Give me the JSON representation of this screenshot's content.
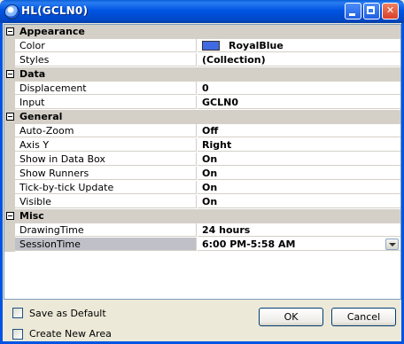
{
  "window": {
    "title": "HL(GCLN0)"
  },
  "grid": {
    "categories": [
      {
        "label": "Appearance",
        "props": [
          {
            "name": "Color",
            "value": "RoyalBlue",
            "swatch": "#4169e1"
          },
          {
            "name": "Styles",
            "value": "(Collection)"
          }
        ]
      },
      {
        "label": "Data",
        "props": [
          {
            "name": "Displacement",
            "value": "0"
          },
          {
            "name": "Input",
            "value": "GCLN0"
          }
        ]
      },
      {
        "label": "General",
        "props": [
          {
            "name": "Auto-Zoom",
            "value": "Off"
          },
          {
            "name": "Axis Y",
            "value": "Right"
          },
          {
            "name": "Show in Data Box",
            "value": "On"
          },
          {
            "name": "Show Runners",
            "value": "On"
          },
          {
            "name": "Tick-by-tick Update",
            "value": "On"
          },
          {
            "name": "Visible",
            "value": "On"
          }
        ]
      },
      {
        "label": "Misc",
        "props": [
          {
            "name": "DrawingTime",
            "value": "24 hours"
          },
          {
            "name": "SessionTime",
            "value": "6:00 PM-5:58 AM",
            "selected": true
          }
        ]
      }
    ]
  },
  "footer": {
    "save_default_label": "Save as Default",
    "create_area_label": "Create New Area",
    "ok_label": "OK",
    "cancel_label": "Cancel"
  },
  "colors": {
    "titlebar": "#0054e3",
    "category_bg": "#d4d0c8",
    "selected_row": "#c0c0c8",
    "swatch": "#4169e1"
  }
}
